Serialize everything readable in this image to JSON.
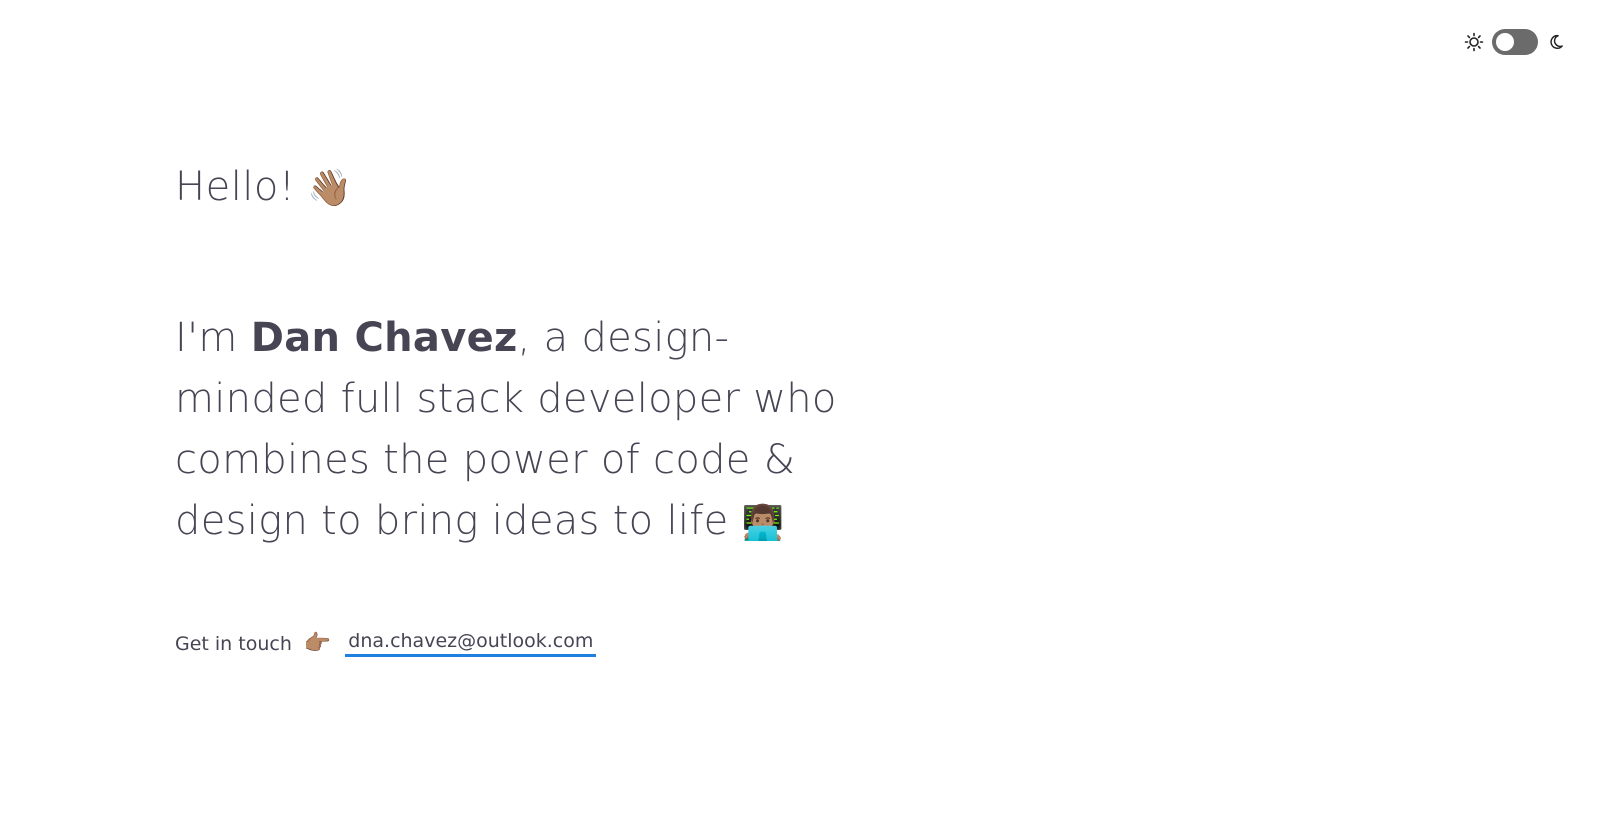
{
  "theme_toggle": {
    "light_icon": "sun-icon",
    "dark_icon": "moon-icon",
    "state": "light"
  },
  "hero": {
    "greeting": "Hello!",
    "greeting_emoji": "👋🏽",
    "intro_prefix": "I'm ",
    "name": "Dan Chavez",
    "intro_suffix": ", a design-minded full stack developer who combines the power of code & design to bring ideas to life",
    "intro_emoji": "👨🏽‍💻"
  },
  "contact": {
    "label": "Get in touch",
    "pointer_emoji": "👉🏽",
    "email": "dna.chavez@outlook.com"
  },
  "colors": {
    "text": "#474554",
    "link_underline": "#1e7fe0",
    "toggle_track": "#6b6b6b",
    "background": "#ffffff"
  }
}
